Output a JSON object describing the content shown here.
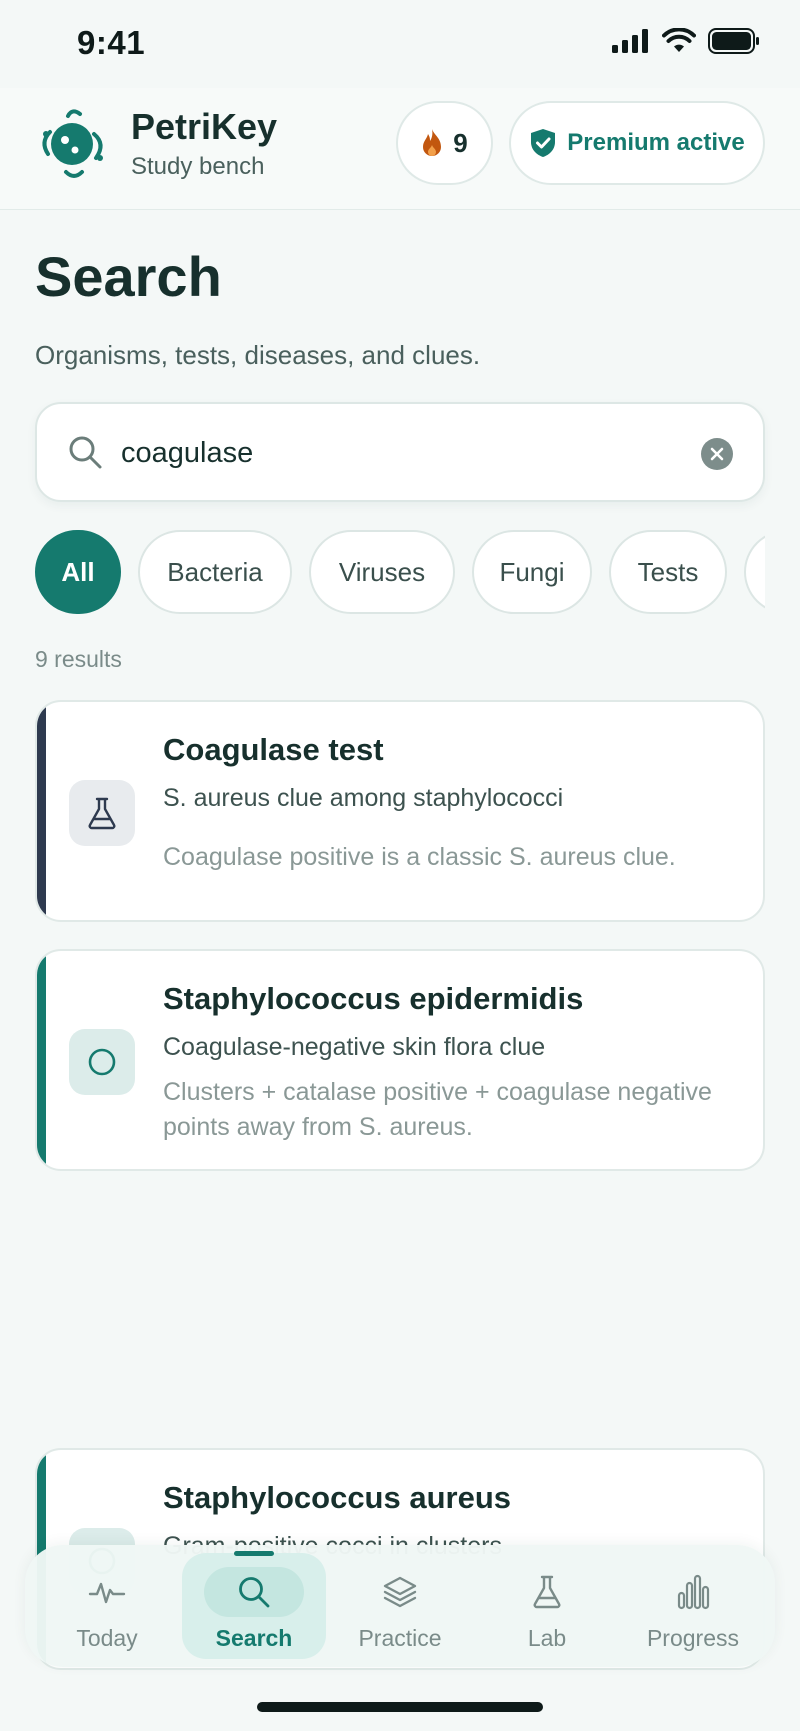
{
  "status_bar": {
    "time": "9:41"
  },
  "header": {
    "brand_name": "PetriKey",
    "brand_subtitle": "Study bench",
    "streak_count": "9",
    "premium_label": "Premium active"
  },
  "page": {
    "title": "Search",
    "subtitle": "Organisms, tests, diseases, and clues."
  },
  "search": {
    "value": "coagulase",
    "placeholder": ""
  },
  "filters": [
    {
      "label": "All",
      "active": true
    },
    {
      "label": "Bacteria",
      "active": false
    },
    {
      "label": "Viruses",
      "active": false
    },
    {
      "label": "Fungi",
      "active": false
    },
    {
      "label": "Tests",
      "active": false
    },
    {
      "label": "",
      "active": false
    }
  ],
  "results_count": "9 results",
  "results": [
    {
      "title": "Coagulase test",
      "subtitle": "S. aureus clue among staphylococci",
      "description": "Coagulase positive is a classic S. aureus clue.",
      "icon": "flask-icon",
      "accent": "#2e3a4f"
    },
    {
      "title": "Staphylococcus epidermidis",
      "subtitle": "Coagulase-negative skin flora clue",
      "description": "Clusters + catalase positive + coagulase negative points away from S. aureus.",
      "icon": "circle-icon",
      "accent": "#157a6e"
    },
    {
      "title": "Staphylococcus aureus",
      "subtitle": "Gram-positive cocci in clusters",
      "description": "",
      "icon": "circle-icon",
      "accent": "#157a6e"
    }
  ],
  "nav": [
    {
      "label": "Today",
      "icon": "pulse-icon",
      "active": false
    },
    {
      "label": "Search",
      "icon": "search-icon",
      "active": true
    },
    {
      "label": "Practice",
      "icon": "layers-icon",
      "active": false
    },
    {
      "label": "Lab",
      "icon": "flask-icon",
      "active": false
    },
    {
      "label": "Progress",
      "icon": "bar-chart-icon",
      "active": false
    }
  ],
  "colors": {
    "accent": "#157a6e",
    "background": "#f4f8f7",
    "text": "#17302d"
  }
}
